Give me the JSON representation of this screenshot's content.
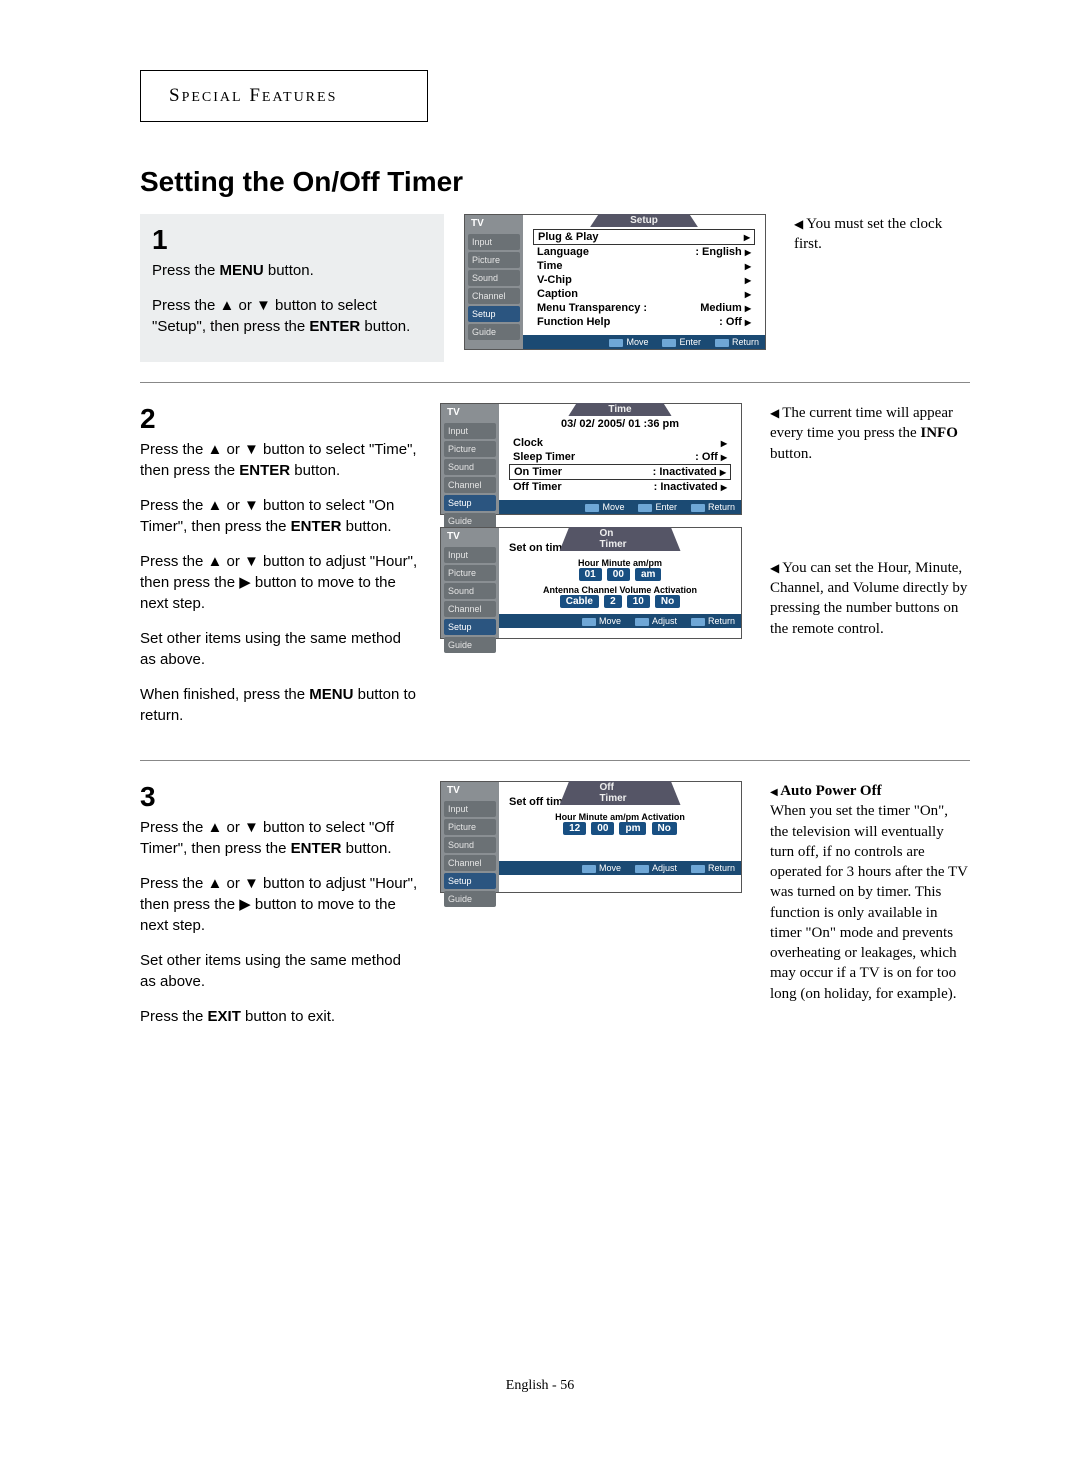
{
  "chapter_word1": "S",
  "chapter_word1b": "PECIAL",
  "chapter_word2": "F",
  "chapter_word2b": "EATURES",
  "title": "Setting the On/Off Timer",
  "step1": {
    "num": "1",
    "p1_a": "Press the ",
    "p1_b": "MENU",
    "p1_c": " button.",
    "p2": "Press the ▲ or ▼ button to select \"Setup\", then press the ",
    "p2b": "ENTER",
    "p2c": " button."
  },
  "step2": {
    "num": "2",
    "p1a": "Press the ▲ or ▼ button to select \"Time\", then press the ",
    "p1b": "ENTER",
    "p1c": " button.",
    "p2a": "Press the ▲ or ▼ button to select \"On Timer\", then press the ",
    "p2b": "ENTER",
    "p2c": " button.",
    "p3a": "Press the ▲ or ▼ button to adjust \"Hour\", then press the ▶ button to move to the next step.",
    "p4": "Set other items using the same method as above.",
    "p5a": "When finished, press the ",
    "p5b": "MENU",
    "p5c": " button to return."
  },
  "step3": {
    "num": "3",
    "p1a": "Press the ▲ or ▼ button to select \"Off Timer\", then press the ",
    "p1b": "ENTER",
    "p1c": " button.",
    "p2": "Press the ▲ or ▼ button to adjust \"Hour\", then press the ▶ button to move to the next step.",
    "p3": "Set other items using the same method as above.",
    "p4a": "Press the ",
    "p4b": "EXIT",
    "p4c": " button to exit."
  },
  "notes": {
    "n1": "You must set the clock first.",
    "n2a": "The current time will appear every time you press the ",
    "n2b": "INFO",
    "n2c": " button.",
    "n3": "You can set the Hour, Minute, Channel, and Volume directly by pressing the number buttons on the remote control.",
    "n4t": "Auto Power Off",
    "n4": "When you set the timer \"On\", the television will eventually turn off, if no controls are operated for 3 hours after the TV was turned on by timer. This function is only available in timer \"On\" mode and prevents overheating or leakages, which may occur if a TV is on for too long (on holiday, for example)."
  },
  "osd_tabs": [
    "Input",
    "Picture",
    "Sound",
    "Channel",
    "Setup",
    "Guide"
  ],
  "osd1": {
    "title": "Setup",
    "rows": [
      {
        "l": "Plug & Play",
        "r": "",
        "hl": true
      },
      {
        "l": "Language",
        "r": ": English"
      },
      {
        "l": "Time",
        "r": ""
      },
      {
        "l": "V-Chip",
        "r": ""
      },
      {
        "l": "Caption",
        "r": ""
      },
      {
        "l": "Menu Transparency :",
        "r": "Medium"
      },
      {
        "l": "Function Help",
        "r": ": Off"
      }
    ],
    "foot": [
      "Move",
      "Enter",
      "Return"
    ]
  },
  "osd2": {
    "title": "Time",
    "date": "03/ 02/ 2005/ 01 :36  pm",
    "rows": [
      {
        "l": "Clock",
        "r": ""
      },
      {
        "l": "Sleep Timer",
        "r": ": Off"
      },
      {
        "l": "On Timer",
        "r": ": Inactivated",
        "hl": true
      },
      {
        "l": "Off Timer",
        "r": ": Inactivated"
      }
    ],
    "foot": [
      "Move",
      "Enter",
      "Return"
    ]
  },
  "osd3": {
    "title": "On Timer",
    "heading": "Set on timer",
    "labels1": "Hour  Minute  am/pm",
    "vals1": [
      "01",
      "00",
      "am"
    ],
    "labels2": "Antenna Channel  Volume Activation",
    "vals2": [
      "Cable",
      "2",
      "10",
      "No"
    ],
    "foot": [
      "Move",
      "Adjust",
      "Return"
    ]
  },
  "osd4": {
    "title": "Off Timer",
    "heading": "Set off timer",
    "labels1": "Hour  Minute  am/pm Activation",
    "vals1": [
      "12",
      "00",
      "pm",
      "No"
    ],
    "foot": [
      "Move",
      "Adjust",
      "Return"
    ]
  },
  "footer": "English - 56"
}
